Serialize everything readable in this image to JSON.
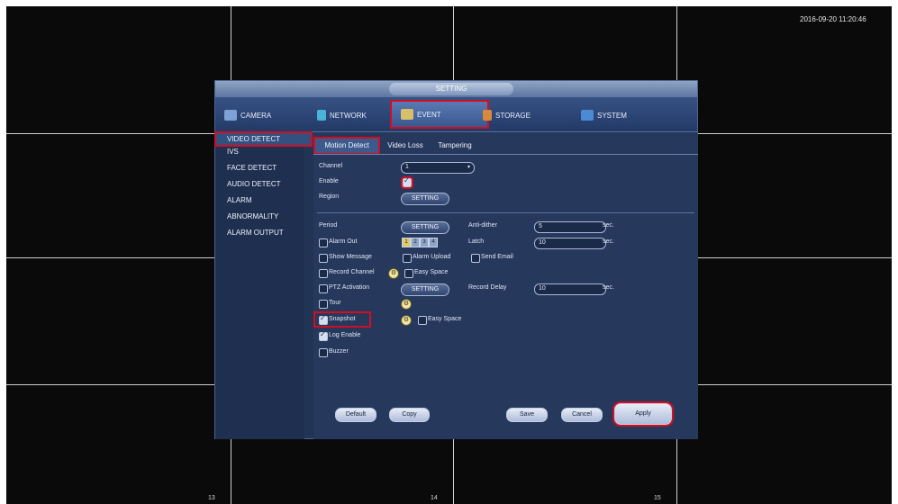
{
  "datetime": "2016-09-20 11:20:46",
  "channel_numbers": [
    "13",
    "14",
    "15"
  ],
  "dialog_title": "SETTING",
  "top_nav": [
    {
      "label": "CAMERA",
      "icon": "camera-icon"
    },
    {
      "label": "NETWORK",
      "icon": "network-icon"
    },
    {
      "label": "EVENT",
      "icon": "event-icon"
    },
    {
      "label": "STORAGE",
      "icon": "storage-icon"
    },
    {
      "label": "SYSTEM",
      "icon": "system-icon"
    }
  ],
  "sidebar": [
    "VIDEO DETECT",
    "IVS",
    "FACE DETECT",
    "AUDIO DETECT",
    "ALARM",
    "ABNORMALITY",
    "ALARM OUTPUT"
  ],
  "tabs": [
    "Motion Detect",
    "Video Loss",
    "Tampering"
  ],
  "form": {
    "channel_label": "Channel",
    "channel_value": "1",
    "enable_label": "Enable",
    "enable_checked": true,
    "region_label": "Region",
    "setting_label": "SETTING",
    "period_label": "Period",
    "anti_dither_label": "Anti-dither",
    "anti_dither_value": "5",
    "sec": "sec.",
    "alarm_out_label": "Alarm Out",
    "alarm_out_channels": [
      "1",
      "2",
      "3",
      "4"
    ],
    "latch_label": "Latch",
    "latch_value": "10",
    "show_message_label": "Show Message",
    "alarm_upload_label": "Alarm Upload",
    "send_email_label": "Send Email",
    "record_channel_label": "Record Channel",
    "easy_space_label": "Easy Space",
    "ptz_activation_label": "PTZ Activation",
    "record_delay_label": "Record Delay",
    "record_delay_value": "10",
    "tour_label": "Tour",
    "snapshot_label": "Snapshot",
    "snapshot_checked": true,
    "easy_space2_label": "Easy Space",
    "log_enable_label": "Log Enable",
    "log_enable_checked": true,
    "buzzer_label": "Buzzer"
  },
  "footer": {
    "default": "Default",
    "copy": "Copy",
    "save": "Save",
    "cancel": "Cancel",
    "apply": "Apply"
  },
  "colors": {
    "highlight": "#d40d22",
    "dialog_bg": "#223456",
    "nav_bg": "#2c4473"
  }
}
